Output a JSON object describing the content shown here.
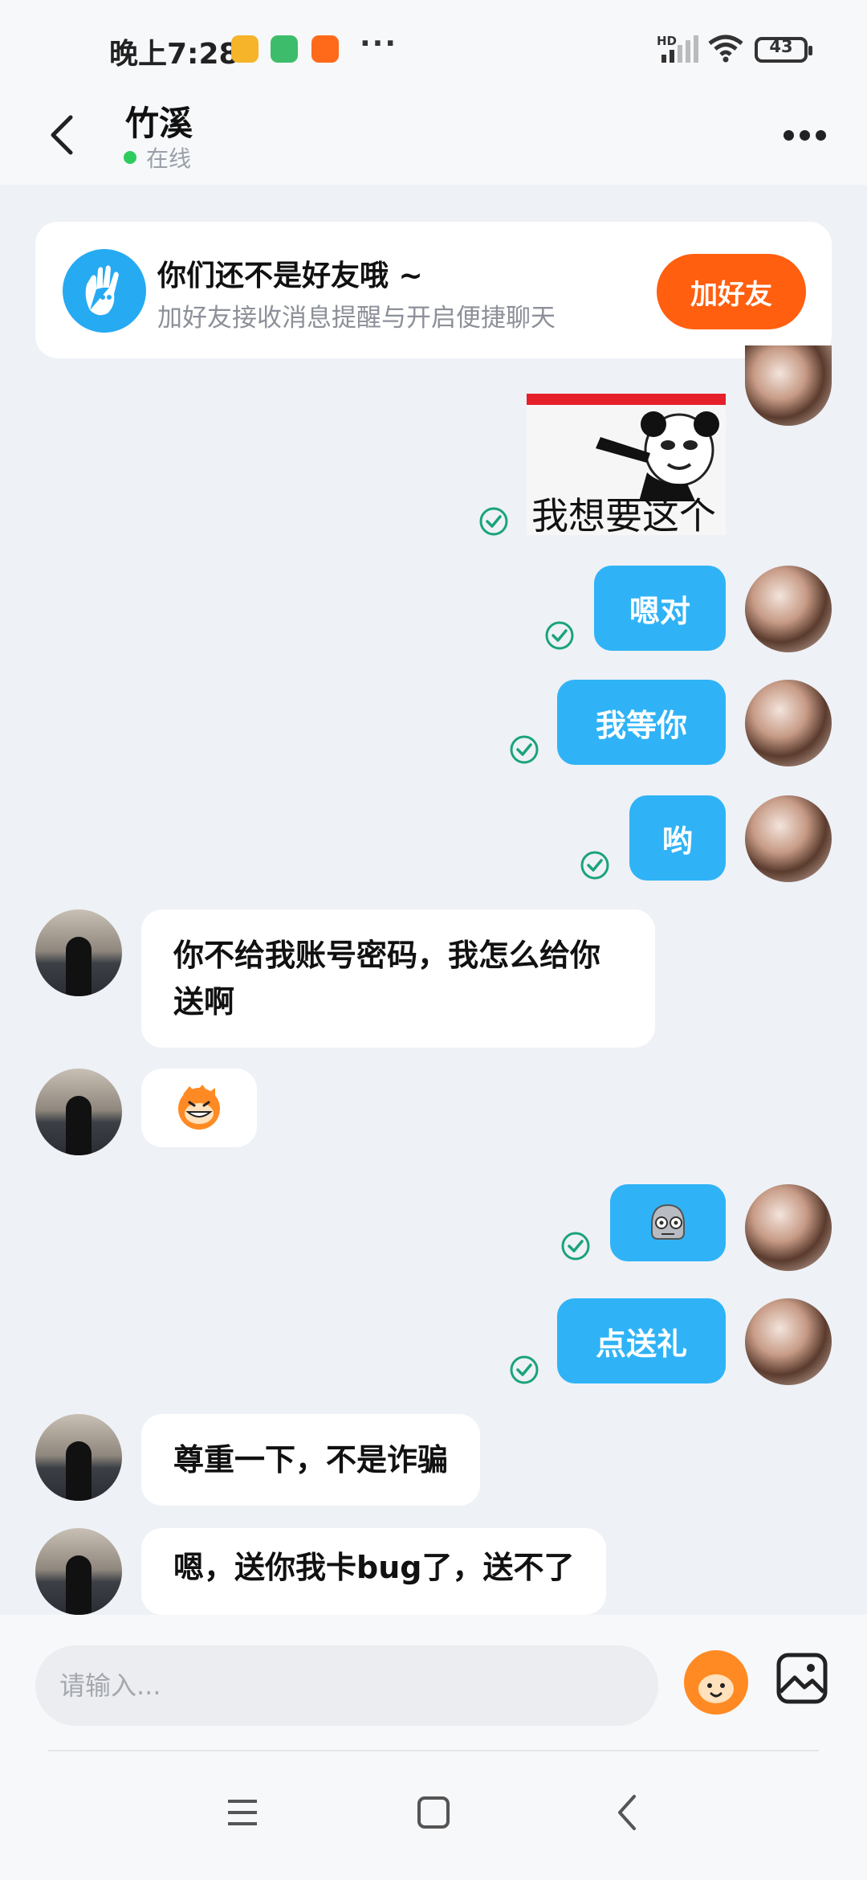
{
  "status_bar": {
    "time": "晚上7:28",
    "more": "···",
    "network": "HD",
    "battery": "43"
  },
  "header": {
    "title": "竹溪",
    "status": "在线"
  },
  "friend_banner": {
    "title": "你们还不是好友哦 ~",
    "subtitle": "加好友接收消息提醒与开启便捷聊天",
    "button": "加好友"
  },
  "messages": [
    {
      "from": "me",
      "type": "sticker",
      "text": "我想要这个",
      "status": "sent"
    },
    {
      "from": "me",
      "type": "text",
      "text": "嗯对",
      "status": "sent"
    },
    {
      "from": "me",
      "type": "text",
      "text": "我等你",
      "status": "sent"
    },
    {
      "from": "me",
      "type": "text",
      "text": "哟",
      "status": "sent"
    },
    {
      "from": "other",
      "type": "text",
      "text": "你不给我账号密码，我怎么给你送啊"
    },
    {
      "from": "other",
      "type": "emoji",
      "icon": "grinning-monkey-emoji"
    },
    {
      "from": "me",
      "type": "emoji",
      "icon": "skull-emoji",
      "status": "sent"
    },
    {
      "from": "me",
      "type": "text",
      "text": "点送礼",
      "status": "sent"
    },
    {
      "from": "other",
      "type": "text",
      "text": "尊重一下，不是诈骗"
    },
    {
      "from": "other",
      "type": "text",
      "text": "嗯，送你我卡bug了，送不了"
    }
  ],
  "input": {
    "placeholder": "请输入..."
  },
  "colors": {
    "bubble_out": "#2fb3f6",
    "accent_button": "#ff5f0f",
    "check": "#1aa37a",
    "online": "#2dcc5c"
  }
}
